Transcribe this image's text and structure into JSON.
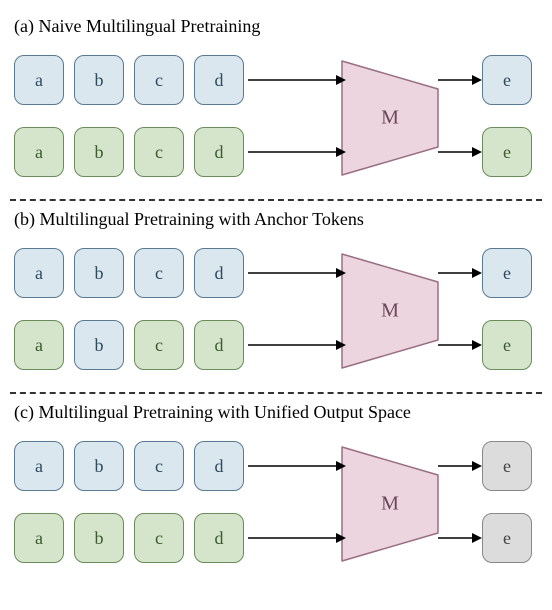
{
  "model_label": "M",
  "sections": [
    {
      "title": "(a) Naive Multilingual Pretraining",
      "rows": [
        {
          "inputs": [
            {
              "t": "a",
              "c": "blue"
            },
            {
              "t": "b",
              "c": "blue"
            },
            {
              "t": "c",
              "c": "blue"
            },
            {
              "t": "d",
              "c": "blue"
            }
          ],
          "output": {
            "t": "e",
            "c": "blue"
          }
        },
        {
          "inputs": [
            {
              "t": "a",
              "c": "green"
            },
            {
              "t": "b",
              "c": "green"
            },
            {
              "t": "c",
              "c": "green"
            },
            {
              "t": "d",
              "c": "green"
            }
          ],
          "output": {
            "t": "e",
            "c": "green"
          }
        }
      ]
    },
    {
      "title": "(b) Multilingual Pretraining with Anchor Tokens",
      "rows": [
        {
          "inputs": [
            {
              "t": "a",
              "c": "blue"
            },
            {
              "t": "b",
              "c": "blue"
            },
            {
              "t": "c",
              "c": "blue"
            },
            {
              "t": "d",
              "c": "blue"
            }
          ],
          "output": {
            "t": "e",
            "c": "blue"
          }
        },
        {
          "inputs": [
            {
              "t": "a",
              "c": "green"
            },
            {
              "t": "b",
              "c": "blue"
            },
            {
              "t": "c",
              "c": "green"
            },
            {
              "t": "d",
              "c": "green"
            }
          ],
          "output": {
            "t": "e",
            "c": "green"
          }
        }
      ]
    },
    {
      "title": "(c) Multilingual Pretraining with Unified Output Space",
      "rows": [
        {
          "inputs": [
            {
              "t": "a",
              "c": "blue"
            },
            {
              "t": "b",
              "c": "blue"
            },
            {
              "t": "c",
              "c": "blue"
            },
            {
              "t": "d",
              "c": "blue"
            }
          ],
          "output": {
            "t": "e",
            "c": "gray"
          }
        },
        {
          "inputs": [
            {
              "t": "a",
              "c": "green"
            },
            {
              "t": "b",
              "c": "green"
            },
            {
              "t": "c",
              "c": "green"
            },
            {
              "t": "d",
              "c": "green"
            }
          ],
          "output": {
            "t": "e",
            "c": "gray"
          }
        }
      ]
    }
  ]
}
